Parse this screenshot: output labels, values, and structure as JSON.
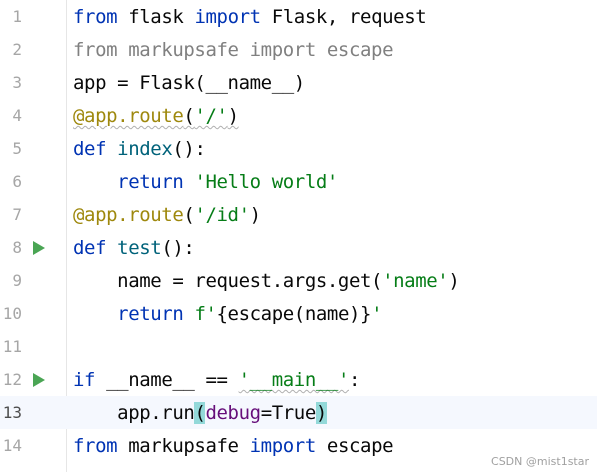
{
  "editor": {
    "lines": [
      {
        "number": "1",
        "tokens": [
          [
            "kw",
            "from"
          ],
          [
            "",
            "flask"
          ],
          [
            "kw",
            "import"
          ],
          [
            "",
            "Flask, request"
          ]
        ]
      },
      {
        "number": "2",
        "tokens": [
          [
            "grey",
            "from markupsafe import escape"
          ]
        ]
      },
      {
        "number": "3",
        "tokens": [
          [
            "",
            "app = Flask(__name__)"
          ]
        ]
      },
      {
        "number": "4",
        "tokens": [
          [
            "deco",
            "@app.route"
          ],
          [
            "",
            "("
          ],
          [
            "str",
            "'/'"
          ],
          [
            "",
            ")"
          ]
        ]
      },
      {
        "number": "5",
        "tokens": [
          [
            "kw",
            "def"
          ],
          [
            "fn",
            "index"
          ],
          [
            "",
            "():"
          ]
        ]
      },
      {
        "number": "6",
        "tokens": [
          [
            "kw",
            "return"
          ],
          [
            "str",
            "'Hello world'"
          ]
        ]
      },
      {
        "number": "7",
        "tokens": [
          [
            "deco",
            "@app.route"
          ],
          [
            "",
            "("
          ],
          [
            "str",
            "'/id'"
          ],
          [
            "",
            ")"
          ]
        ]
      },
      {
        "number": "8",
        "tokens": [
          [
            "kw",
            "def"
          ],
          [
            "fn",
            "test"
          ],
          [
            "",
            "():"
          ]
        ]
      },
      {
        "number": "9",
        "tokens": [
          [
            "",
            "name = request.args.get("
          ],
          [
            "str",
            "'name'"
          ],
          [
            "",
            ")"
          ]
        ]
      },
      {
        "number": "10",
        "tokens": [
          [
            "kw",
            "return"
          ],
          [
            "str",
            "f'"
          ],
          [
            "",
            "{escape(name)}"
          ],
          [
            "str",
            "'"
          ]
        ]
      },
      {
        "number": "11",
        "tokens": []
      },
      {
        "number": "12",
        "tokens": [
          [
            "kw",
            "if"
          ],
          [
            "",
            "__name__ == "
          ],
          [
            "str",
            "'__main__'"
          ],
          [
            "",
            ":"
          ]
        ]
      },
      {
        "number": "13",
        "tokens": [
          [
            "",
            "app.run("
          ],
          [
            "param",
            "debug"
          ],
          [
            "",
            "=True)"
          ]
        ]
      },
      {
        "number": "14",
        "tokens": [
          [
            "kw",
            "from"
          ],
          [
            "",
            "markupsafe"
          ],
          [
            "kw",
            "import"
          ],
          [
            "",
            "escape"
          ]
        ]
      }
    ],
    "run_gutter_lines": [
      "8",
      "12"
    ],
    "current_line": "13"
  },
  "watermark": "CSDN @mist1star",
  "colors": {
    "keyword": "#0033b3",
    "string": "#067d17",
    "decorator": "#9e880d",
    "unused_import": "#808080",
    "named_param": "#660e7a",
    "run_icon": "#4aa554",
    "current_line_bg": "#f5f8fe"
  },
  "icons": {
    "run": "run-triangle-icon"
  }
}
